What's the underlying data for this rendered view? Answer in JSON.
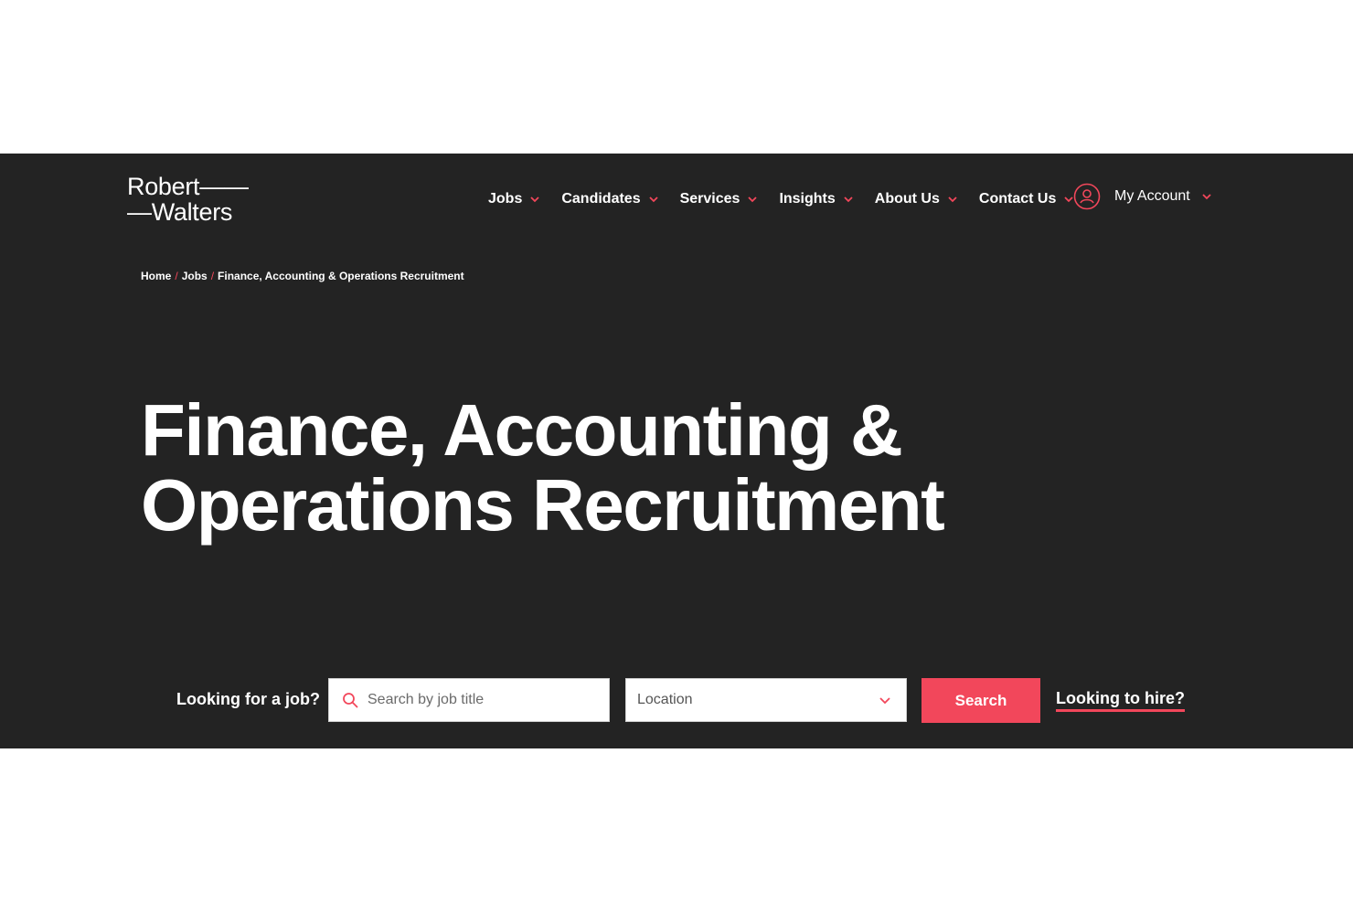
{
  "brand": {
    "logo_line1": "Robert——",
    "logo_line2": "—Walters"
  },
  "nav": {
    "items": [
      {
        "label": "Jobs"
      },
      {
        "label": "Candidates"
      },
      {
        "label": "Services"
      },
      {
        "label": "Insights"
      },
      {
        "label": "About Us"
      },
      {
        "label": "Contact Us"
      }
    ],
    "account_label": "My Account"
  },
  "breadcrumb": {
    "items": [
      "Home",
      "Jobs",
      "Finance, Accounting & Operations Recruitment"
    ],
    "separator": "/"
  },
  "hero": {
    "title_line1": "Finance, Accounting &",
    "title_line2": "Operations Recruitment"
  },
  "search": {
    "prompt": "Looking for a job?",
    "job_placeholder": "Search by job title",
    "job_value": "",
    "location_value": "Location",
    "button_label": "Search",
    "hire_link": "Looking to hire?"
  },
  "colors": {
    "accent": "#f2475b",
    "background": "#232323",
    "text": "#ffffff"
  },
  "icons": {
    "account": "user-circle-icon",
    "search": "search-icon",
    "chevron": "chevron-down-icon"
  }
}
